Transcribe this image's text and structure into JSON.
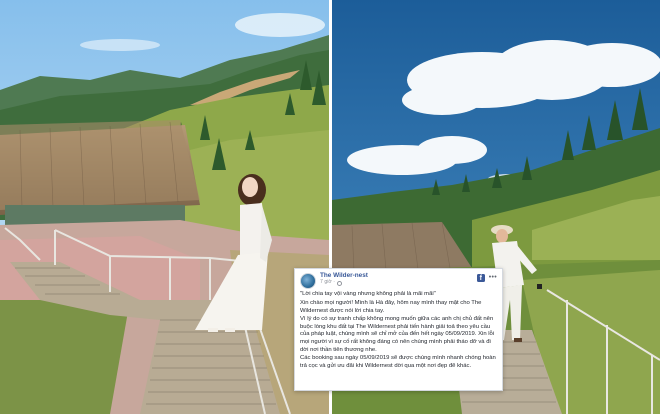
{
  "left_photo": {
    "description_icon": "girl-on-boardwalk-photo"
  },
  "right_photo": {
    "description_icon": "man-on-boardwalk-photo"
  },
  "post": {
    "page_name": "The Wilder-nest",
    "time": "7 giờ ·",
    "icons": [
      "globe-icon",
      "facebook-icon",
      "more-icon"
    ],
    "paragraphs": [
      "\"Lời chia tay vội vàng nhưng không phải là mãi mãi\"",
      "Xin chào mọi người! Mình là Hà đây, hôm nay mình thay mặt cho The Wildernest được nói lời chia tay.",
      "Vì lý do có sự tranh chấp không mong muốn giữa các anh chị chủ đất nên buộc lòng khu đất tại The Wildernest phải tiến hành giải toả theo yêu cầu của pháp luật, chúng mình sẽ chỉ mở của đến hết ngày 05/09/2019. Xin lỗi mọi người vì sự cố rất không đáng có nên chúng mình phải tháo dỡ và đi dời nơi thần tiên thương nhe.",
      "Các booking sau ngày 05/09/2019 sẽ được chúng mình nhanh chóng hoàn trả cọc và gửi ưu đãi khi Wildernest dời qua một nơi đẹp đẽ khác."
    ]
  },
  "colors": {
    "facebook_blue": "#3b5998",
    "page_name_blue": "#385898",
    "sky_left": "#9ecbee",
    "sky_right": "#2f77b6"
  }
}
